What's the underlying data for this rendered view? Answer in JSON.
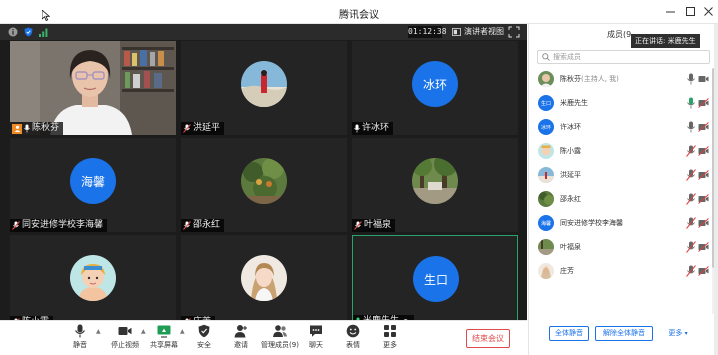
{
  "window": {
    "title": "腾讯会议",
    "controls": [
      "minimize-icon",
      "maximize-icon",
      "close-icon"
    ]
  },
  "status": {
    "timer": "01:12:38",
    "speaker_view_label": "演讲者视图",
    "icons": [
      "info-icon",
      "shield-icon",
      "signal-icon",
      "fullscreen-icon"
    ]
  },
  "participants": [
    {
      "name": "陈秋芬",
      "type": "video",
      "host": true,
      "mic": "on"
    },
    {
      "name": "洪延平",
      "type": "photo",
      "mic": "muted"
    },
    {
      "name": "许冰环",
      "type": "initials",
      "initials": "冰环",
      "mic": "on"
    },
    {
      "name": "同安进修学校李海馨",
      "type": "initials",
      "initials": "海馨",
      "mic": "muted"
    },
    {
      "name": "邵永红",
      "type": "photo",
      "mic": "muted"
    },
    {
      "name": "叶福泉",
      "type": "photo",
      "mic": "muted"
    },
    {
      "name": "陈小露",
      "type": "photo",
      "mic": "muted"
    },
    {
      "name": "庄芳",
      "type": "photo",
      "mic": "muted"
    },
    {
      "name": "米鹿先生",
      "type": "initials",
      "initials": "生口",
      "mic": "on",
      "active": true
    }
  ],
  "toolbar": {
    "mute": "静音",
    "stop_video": "停止视频",
    "share_screen": "共享屏幕",
    "security": "安全",
    "invite": "邀请",
    "manage_members": "管理成员(9)",
    "chat": "聊天",
    "reactions": "表情",
    "more": "更多",
    "end_meeting": "结束会议"
  },
  "members_panel": {
    "title": "成员(9",
    "speaking_label": "正在讲话: 米鹿先生",
    "search_placeholder": "搜索成员",
    "members": [
      {
        "name": "陈秋芬",
        "suffix": "(主持人, 我)",
        "avatar": "photo",
        "mic": "on",
        "cam": "on"
      },
      {
        "name": "米鹿先生",
        "suffix": "",
        "avatar": "initials",
        "initials": "生口",
        "mic": "on",
        "cam": "off"
      },
      {
        "name": "许冰环",
        "suffix": "",
        "avatar": "initials",
        "initials": "冰环",
        "mic": "on",
        "cam": "off"
      },
      {
        "name": "陈小露",
        "suffix": "",
        "avatar": "photo",
        "mic": "muted",
        "cam": "off"
      },
      {
        "name": "洪延平",
        "suffix": "",
        "avatar": "photo",
        "mic": "muted",
        "cam": "off"
      },
      {
        "name": "邵永红",
        "suffix": "",
        "avatar": "photo",
        "mic": "muted",
        "cam": "off"
      },
      {
        "name": "同安进修学校李海馨",
        "suffix": "",
        "avatar": "initials",
        "initials": "海馨",
        "mic": "muted",
        "cam": "off"
      },
      {
        "name": "叶福泉",
        "suffix": "",
        "avatar": "photo",
        "mic": "muted",
        "cam": "off"
      },
      {
        "name": "庄芳",
        "suffix": "",
        "avatar": "photo",
        "mic": "muted",
        "cam": "off"
      }
    ],
    "footer": {
      "mute_all": "全体静音",
      "unmute_all": "解除全体静音",
      "more": "更多"
    }
  },
  "colors": {
    "accent": "#1a73e8",
    "end_meeting": "#e24b4b",
    "active_speaker_border": "#2aa36b",
    "muted_mic": "#d94040",
    "stage_background": "#1c1c1c"
  }
}
